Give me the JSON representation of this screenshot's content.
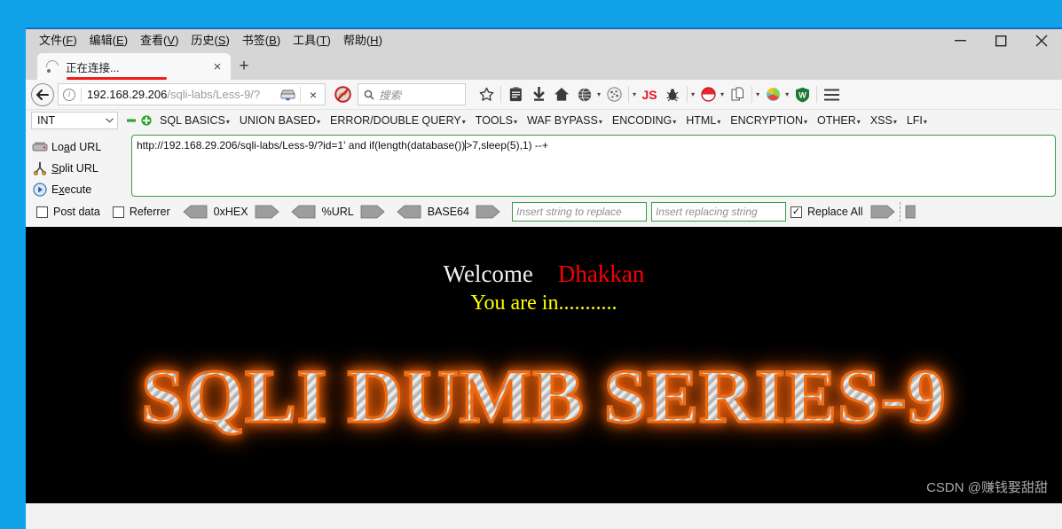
{
  "window": {
    "menubar": [
      {
        "label": "文件",
        "accel": "F"
      },
      {
        "label": "编辑",
        "accel": "E"
      },
      {
        "label": "查看",
        "accel": "V"
      },
      {
        "label": "历史",
        "accel": "S"
      },
      {
        "label": "书签",
        "accel": "B"
      },
      {
        "label": "工具",
        "accel": "T"
      },
      {
        "label": "帮助",
        "accel": "H"
      }
    ],
    "controls": {
      "minimize": "minimize-button",
      "maximize": "maximize-button",
      "close": "close-button"
    }
  },
  "tabs": {
    "active": {
      "title": "正在连接...",
      "close_label": "×",
      "spinner": "loading-spinner-icon"
    },
    "new_tab_label": "+"
  },
  "navbar": {
    "back_label": "←",
    "url": {
      "host": "192.168.29.206",
      "path": "/sqli-labs/Less-9/?",
      "full": "192.168.29.206/sqli-labs/Less-9/?",
      "info_icon": "ⓘ",
      "server_icon": "server-icon",
      "stop_label": "×"
    },
    "search": {
      "placeholder": "搜索",
      "icon": "search-icon"
    },
    "icons": [
      "noscript-blocked-icon",
      "bookmark-star-icon",
      "reader-view-icon",
      "download-arrow-icon",
      "home-icon",
      "globe-icon",
      "cookie-icon",
      "js-icon",
      "bug-icon",
      "burp-icon",
      "pages-icon",
      "proxy-icon",
      "wappalyzer-shield-icon",
      "hamburger-menu-icon"
    ],
    "js_label": "JS",
    "shield_label": "W",
    "menu_label": "☰"
  },
  "hackbar": {
    "type_selector": {
      "value": "INT",
      "caret": "⌄"
    },
    "minus_label": "−",
    "plus_label": "+",
    "menus": [
      "SQL BASICS",
      "UNION BASED",
      "ERROR/DOUBLE QUERY",
      "TOOLS",
      "WAF BYPASS",
      "ENCODING",
      "HTML",
      "ENCRYPTION",
      "OTHER",
      "XSS",
      "LFI"
    ],
    "actions": [
      {
        "label": "Load URL",
        "accel": "a",
        "icon": "load-url-icon"
      },
      {
        "label": "Split URL",
        "accel": "p",
        "icon": "split-url-icon"
      },
      {
        "label": "Execute",
        "accel": "x",
        "icon": "execute-icon"
      }
    ],
    "request_text_before": "http://192.168.29.206/sqli-labs/Less-9/?id=1' and if(length(database())",
    "request_text_after": ">7,sleep(5),1) --+",
    "request_text_full": "http://192.168.29.206/sqli-labs/Less-9/?id=1' and if(length(database())>7,sleep(5),1) --+",
    "options": {
      "post_data": {
        "label": "Post data",
        "checked": false
      },
      "referrer": {
        "label": "Referrer",
        "checked": false
      },
      "encoders": [
        "0xHEX",
        "%URL",
        "BASE64"
      ],
      "replace_search_placeholder": "Insert string to replace",
      "replace_with_placeholder": "Insert replacing string",
      "replace_all": {
        "label": "Replace All",
        "checked": true
      }
    }
  },
  "page": {
    "welcome": "Welcome",
    "user": "Dhakkan",
    "status": "You are in...........",
    "banner": "SQLI DUMB SERIES-9",
    "watermark": "CSDN @赚钱娶甜甜"
  },
  "colors": {
    "accent_green": "#3a9a4a",
    "banner_glow": "#f06a10",
    "user_red": "#fe0000",
    "status_yellow": "#ffff00",
    "desktop_blue": "#10a3e8",
    "annotation_red": "#ee1c1c"
  }
}
